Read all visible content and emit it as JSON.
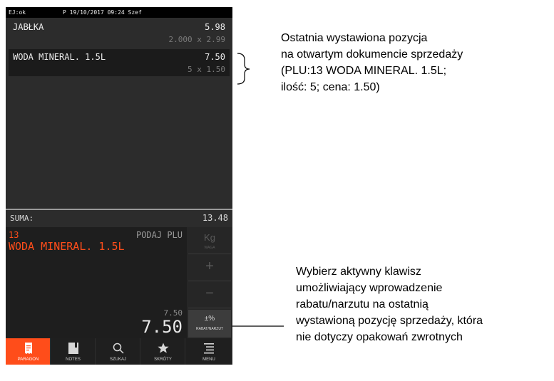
{
  "status_bar": {
    "left": "EJ:ok",
    "center": "P 19/10/2017 09:24 Szef"
  },
  "receipt": {
    "items": [
      {
        "name": "JABŁKA",
        "price": "5.98",
        "qty": "2.000 x 2.99"
      },
      {
        "name": "WODA MINERAL. 1.5L",
        "price": "7.50",
        "qty": "5 x 1.50"
      }
    ],
    "sum_label": "SUMA:",
    "sum_value": "13.48"
  },
  "entry": {
    "plu_number": "13",
    "prompt": "PODAJ PLU",
    "product_name": "WODA MINERAL. 1.5L",
    "small_value": "7.50",
    "big_value": "7.50"
  },
  "side_keys": [
    {
      "symbol": "Kg",
      "label": "WAGA",
      "icon": "kg-icon",
      "active": false
    },
    {
      "symbol": "+",
      "label": "",
      "icon": "plus-icon",
      "active": false
    },
    {
      "symbol": "−",
      "label": "",
      "icon": "minus-icon",
      "active": false
    },
    {
      "symbol": "±%",
      "label": "RABAT/NARZUT",
      "icon": "discount-icon",
      "active": true
    }
  ],
  "tabs": [
    {
      "label": "PARAGON",
      "icon": "receipt-icon",
      "active": true
    },
    {
      "label": "NOTES",
      "icon": "notes-icon",
      "active": false
    },
    {
      "label": "SZUKAJ",
      "icon": "search-icon",
      "active": false
    },
    {
      "label": "SKRÓTY",
      "icon": "star-icon",
      "active": false
    },
    {
      "label": "MENU",
      "icon": "menu-icon",
      "active": false
    }
  ],
  "annotations": {
    "top": [
      "Ostatnia wystawiona pozycja",
      "na otwartym dokumencie sprzedaży",
      "(PLU:13 WODA MINERAL. 1.5L;",
      "ilość: 5; cena: 1.50)"
    ],
    "bottom": [
      "Wybierz aktywny klawisz",
      "umożliwiający wprowadzenie",
      "rabatu/narzutu na ostatnią",
      "wystawioną pozycję sprzedaży, która",
      "nie dotyczy opakowań zwrotnych"
    ]
  },
  "colors": {
    "accent": "#ff4d1a",
    "panel": "#2c2c2c",
    "dark": "#1a1a1a"
  }
}
